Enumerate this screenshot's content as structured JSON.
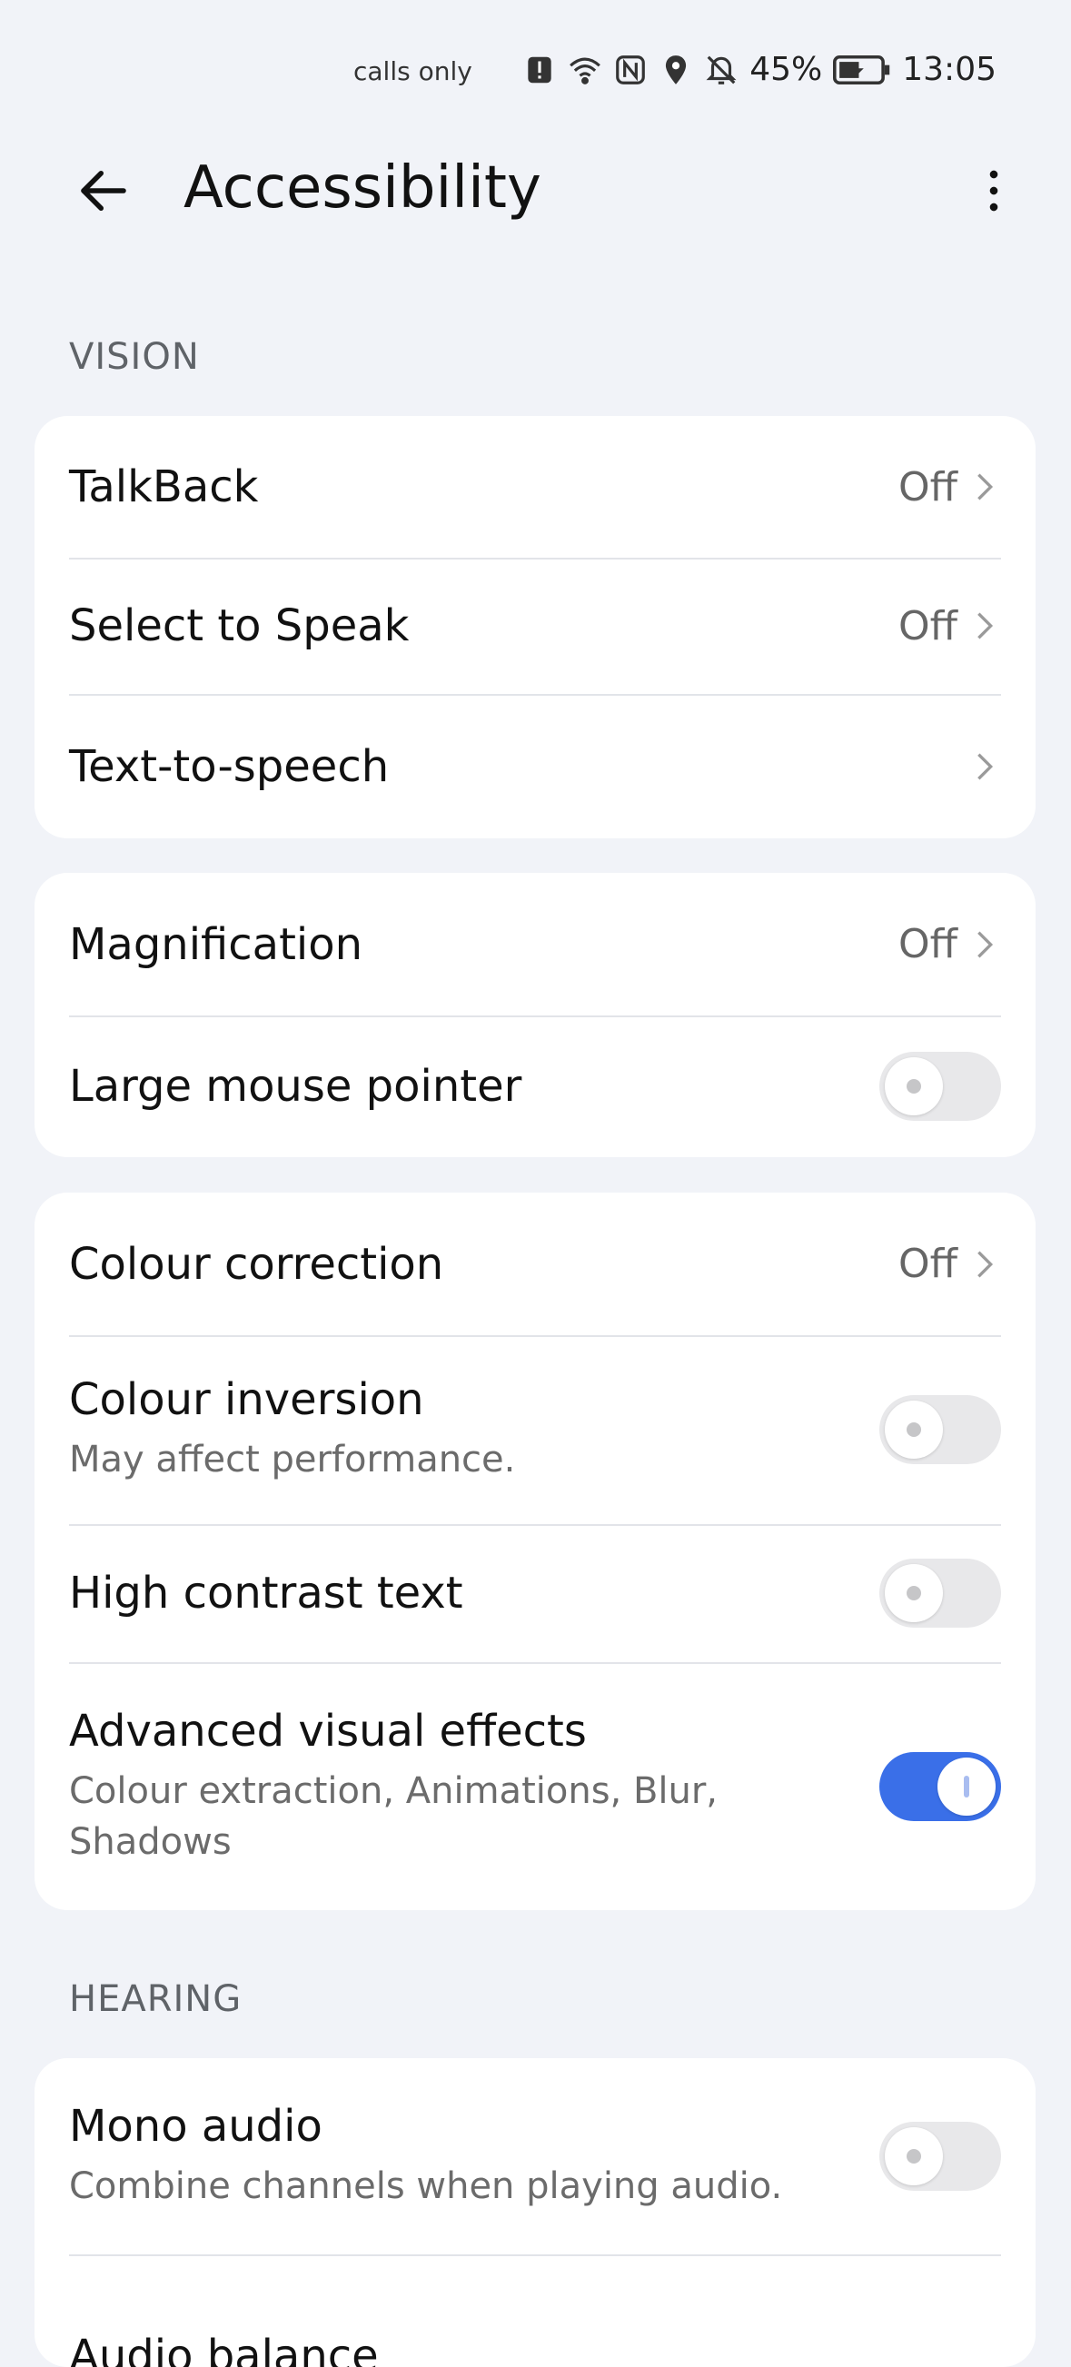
{
  "status_bar": {
    "carrier": "calls only",
    "battery_text": "45%",
    "time": "13:05",
    "icons": [
      "alert-icon",
      "wifi-icon",
      "nfc-icon",
      "location-icon",
      "silent-bell-icon",
      "battery-icon"
    ]
  },
  "header": {
    "title": "Accessibility",
    "back_icon": "back-arrow-icon",
    "more_icon": "more-vertical-icon"
  },
  "sections": {
    "vision_label": "VISION",
    "hearing_label": "HEARING"
  },
  "vision_card1": [
    {
      "title": "TalkBack",
      "value": "Off"
    },
    {
      "title": "Select to Speak",
      "value": "Off"
    },
    {
      "title": "Text-to-speech",
      "value": ""
    }
  ],
  "vision_card2": [
    {
      "title": "Magnification",
      "value": "Off"
    },
    {
      "title": "Large mouse pointer",
      "toggle": false
    }
  ],
  "vision_card3": [
    {
      "title": "Colour correction",
      "value": "Off"
    },
    {
      "title": "Colour inversion",
      "subtitle": "May affect performance.",
      "toggle": false
    },
    {
      "title": "High contrast text",
      "toggle": false
    },
    {
      "title": "Advanced visual effects",
      "subtitle": "Colour extraction, Animations, Blur, Shadows",
      "toggle": true
    }
  ],
  "hearing_card1": [
    {
      "title": "Mono audio",
      "subtitle": "Combine channels when playing audio.",
      "toggle": false
    },
    {
      "title": "Audio balance"
    }
  ],
  "colors": {
    "background": "#F1F3F8",
    "card": "#FFFFFF",
    "accent": "#3A6FE8"
  }
}
